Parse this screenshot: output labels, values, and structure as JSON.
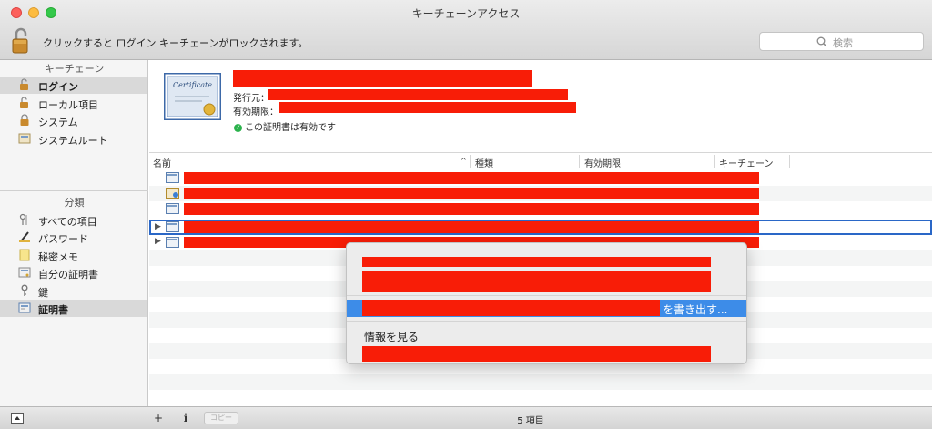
{
  "window": {
    "title": "キーチェーンアクセス"
  },
  "toolbar": {
    "lock_message": "クリックすると ログイン キーチェーンがロックされます。"
  },
  "search": {
    "placeholder": "検索"
  },
  "sidebar": {
    "keychains_heading": "キーチェーン",
    "keychains": [
      {
        "label": "ログイン",
        "icon": "unlocked-padlock-icon",
        "selected": true
      },
      {
        "label": "ローカル項目",
        "icon": "unlocked-padlock-icon",
        "selected": false
      },
      {
        "label": "システム",
        "icon": "locked-padlock-icon",
        "selected": false
      },
      {
        "label": "システムルート",
        "icon": "certificate-folder-icon",
        "selected": false
      }
    ],
    "categories_heading": "分類",
    "categories": [
      {
        "label": "すべての項目",
        "icon": "keys-icon",
        "selected": false
      },
      {
        "label": "パスワード",
        "icon": "password-pen-icon",
        "selected": false
      },
      {
        "label": "秘密メモ",
        "icon": "note-icon",
        "selected": false
      },
      {
        "label": "自分の証明書",
        "icon": "my-certificate-icon",
        "selected": false
      },
      {
        "label": "鍵",
        "icon": "key-icon",
        "selected": false
      },
      {
        "label": "証明書",
        "icon": "certificate-icon",
        "selected": true
      }
    ]
  },
  "detail": {
    "certificate_image_text": "Certificate",
    "issuer_label": "発行元：",
    "expiry_label": "有効期限：",
    "valid_message": "この証明書は有効です"
  },
  "table": {
    "columns": [
      "名前",
      "種類",
      "有効期限",
      "キーチェーン"
    ],
    "rows": [
      {
        "expandable": false,
        "icon": "certificate-icon",
        "selected": false
      },
      {
        "expandable": false,
        "icon": "certificate-badge-icon",
        "selected": false
      },
      {
        "expandable": false,
        "icon": "certificate-icon",
        "selected": false
      },
      {
        "expandable": true,
        "icon": "certificate-icon",
        "selected": true
      },
      {
        "expandable": true,
        "icon": "certificate-icon",
        "selected": false
      }
    ]
  },
  "context_menu": {
    "export_suffix": "を書き出す...",
    "get_info": "情報を見る"
  },
  "bottom_bar": {
    "add_label": "+",
    "info_label": "i",
    "copy_label": "コピー",
    "item_count": "5 項目"
  },
  "colors": {
    "redaction": "#f81d07",
    "selection": "#3d8ce8",
    "valid": "#2bb24c"
  }
}
